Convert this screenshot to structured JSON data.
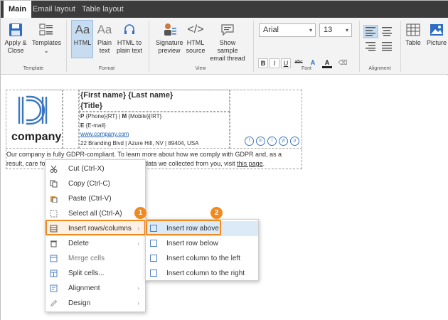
{
  "tabs": [
    {
      "label": "Main",
      "active": true
    },
    {
      "label": "Email layout",
      "active": false
    },
    {
      "label": "Table layout",
      "active": false
    }
  ],
  "ribbon": {
    "template": {
      "apply_close": [
        "Apply &",
        "Close"
      ],
      "templates": "Templates",
      "group": "Template"
    },
    "format": {
      "html": "HTML",
      "plain_text": [
        "Plain",
        "text"
      ],
      "html_to_plain": [
        "HTML to",
        "plain text"
      ],
      "group": "Format"
    },
    "view": {
      "signature_preview": [
        "Signature",
        "preview"
      ],
      "html_source": [
        "HTML",
        "source"
      ],
      "sample_thread": [
        "Show sample",
        "email thread"
      ],
      "group": "View"
    },
    "font": {
      "family": "Arial",
      "size": "13",
      "bold": "B",
      "italic": "I",
      "underline": "U",
      "strike": "abc",
      "group": "Font"
    },
    "alignment": {
      "group": "Alignment"
    },
    "insert": {
      "table": "Table",
      "picture": "Picture"
    }
  },
  "signature": {
    "logo_text": "company",
    "name": "{First name} {Last name}",
    "title": "{Title}",
    "phone_prefix_p": "P",
    "phone": " {Phone}{RT} | ",
    "mobile_prefix_m": "M",
    "mobile": " {Mobile}{/RT}",
    "email_prefix_e": "E",
    "email": " {E-mail}",
    "website": "www.company.com",
    "address": "22 Branding Blvd | Azure Hill, NV | 89404, USA",
    "social": [
      "f",
      "in",
      "t",
      "yt",
      "p"
    ],
    "disclaimer_1": "Our company is fully GDPR-compliant. To learn more about how we comply with GDPR and, as a",
    "disclaimer_2a": "result, care fo",
    "disclaimer_2b": "nal data we collected from you, visit ",
    "disclaimer_link": "this page",
    "disclaimer_end": "."
  },
  "context_menu": [
    {
      "label": "Cut (Ctrl-X)",
      "icon": "scissors-icon",
      "enabled": true
    },
    {
      "label": "Copy (Ctrl-C)",
      "icon": "copy-icon",
      "enabled": true
    },
    {
      "label": "Paste (Ctrl-V)",
      "icon": "paste-icon",
      "enabled": true
    },
    {
      "label": "Select all (Ctrl-A)",
      "icon": "select-all-icon",
      "enabled": true
    },
    {
      "label": "Insert rows/columns",
      "icon": "table-rows-icon",
      "enabled": true,
      "submenu": true
    },
    {
      "label": "Delete",
      "icon": "trash-icon",
      "enabled": true,
      "submenu": true
    },
    {
      "label": "Merge cells",
      "icon": "merge-cells-icon",
      "enabled": false
    },
    {
      "label": "Split cells...",
      "icon": "split-cells-icon",
      "enabled": true
    },
    {
      "label": "Alignment",
      "icon": "alignment-icon",
      "enabled": true,
      "submenu": true
    },
    {
      "label": "Design",
      "icon": "pencil-icon",
      "enabled": true,
      "submenu": true
    }
  ],
  "submenu": [
    {
      "label": "Insert row above"
    },
    {
      "label": "Insert row below"
    },
    {
      "label": "Insert column to the left"
    },
    {
      "label": "Insert column to the right"
    }
  ],
  "badges": [
    "1",
    "2"
  ],
  "colors": {
    "accent": "#f08a1e",
    "link": "#1a5fb4",
    "selected": "#c7dcf1",
    "logo": "#3a77c2"
  }
}
